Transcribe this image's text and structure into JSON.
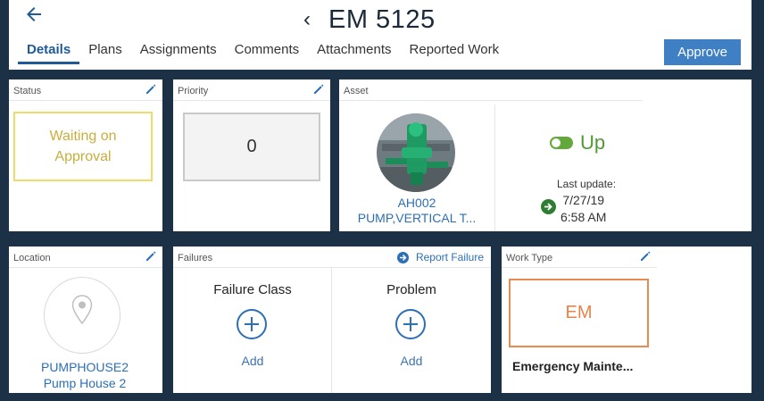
{
  "header": {
    "title": "EM 5125",
    "tabs": [
      {
        "label": "Details",
        "active": true
      },
      {
        "label": "Plans"
      },
      {
        "label": "Assignments"
      },
      {
        "label": "Comments"
      },
      {
        "label": "Attachments"
      },
      {
        "label": "Reported Work"
      }
    ],
    "approve_label": "Approve"
  },
  "status": {
    "label": "Status",
    "value": "Waiting on Approval",
    "value_line1": "Waiting on",
    "value_line2": "Approval"
  },
  "priority": {
    "label": "Priority",
    "value": "0"
  },
  "asset": {
    "label": "Asset",
    "id": "AH002",
    "description": "PUMP,VERTICAL T...",
    "state": "Up",
    "last_update_label": "Last update:",
    "last_update_date": "7/27/19",
    "last_update_time": "6:58 AM"
  },
  "location": {
    "label": "Location",
    "code": "PUMPHOUSE2",
    "name": "Pump House 2"
  },
  "failures": {
    "label": "Failures",
    "report_label": "Report Failure",
    "failure_class": {
      "title": "Failure Class",
      "add_label": "Add"
    },
    "problem": {
      "title": "Problem",
      "add_label": "Add"
    }
  },
  "work_type": {
    "label": "Work Type",
    "code": "EM",
    "description": "Emergency Mainte..."
  },
  "colors": {
    "background": "#1c3046",
    "accent_blue": "#2d6fb6",
    "approve_button": "#3f80c4",
    "status_yellow": "#eddc6a",
    "up_green": "#4f9a35",
    "work_type_orange": "#e88a52"
  }
}
